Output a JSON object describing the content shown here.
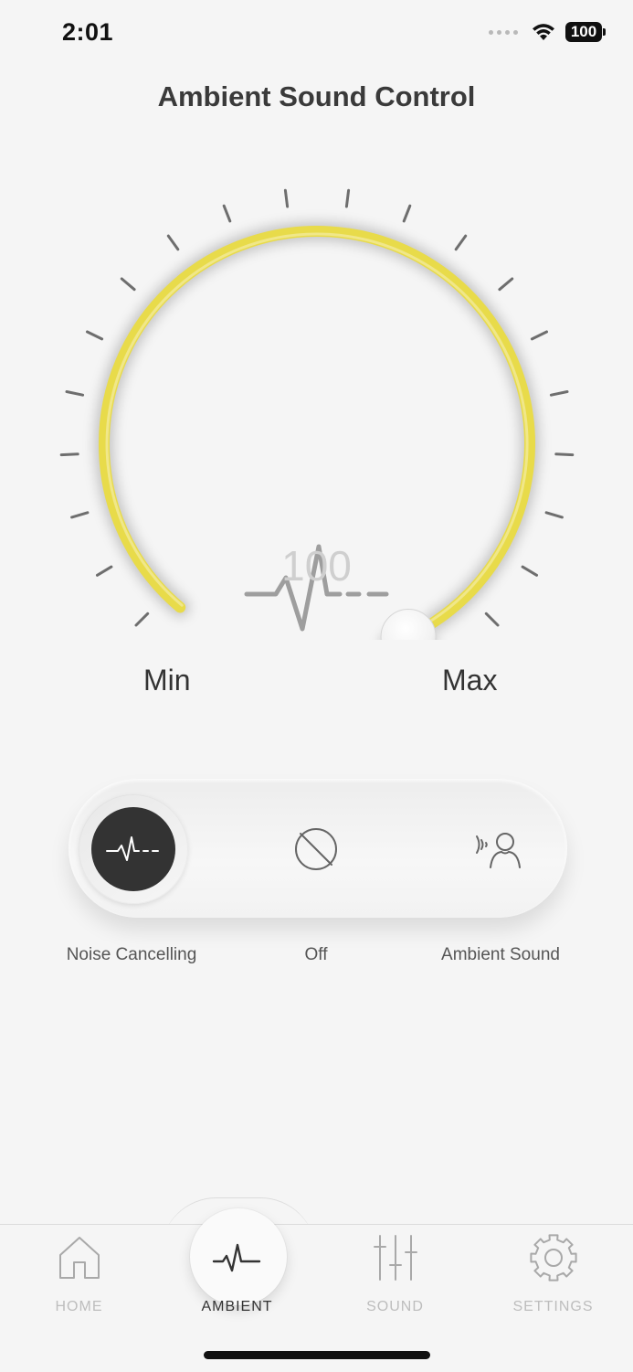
{
  "status_bar": {
    "time": "2:01",
    "battery": "100",
    "icons": [
      "signal-dots-icon",
      "wifi-icon",
      "battery-icon"
    ]
  },
  "header": {
    "title": "Ambient Sound Control"
  },
  "dial": {
    "value": "100",
    "level_percent": 100,
    "min_label": "Min",
    "max_label": "Max",
    "accent_color": "#e8db4a",
    "center_icon": "waveform-icon"
  },
  "modes": {
    "selected": "noise_cancelling",
    "items": [
      {
        "id": "noise_cancelling",
        "label": "Noise Cancelling",
        "icon": "waveform-icon"
      },
      {
        "id": "off",
        "label": "Off",
        "icon": "circle-slash-icon"
      },
      {
        "id": "ambient",
        "label": "Ambient Sound",
        "icon": "person-sound-icon"
      }
    ]
  },
  "tabbar": {
    "selected": "ambient",
    "items": [
      {
        "id": "home",
        "label": "HOME",
        "icon": "home-icon"
      },
      {
        "id": "ambient",
        "label": "AMBIENT",
        "icon": "waveform-icon"
      },
      {
        "id": "sound",
        "label": "SOUND",
        "icon": "sliders-icon"
      },
      {
        "id": "settings",
        "label": "SETTINGS",
        "icon": "gear-icon"
      }
    ]
  }
}
